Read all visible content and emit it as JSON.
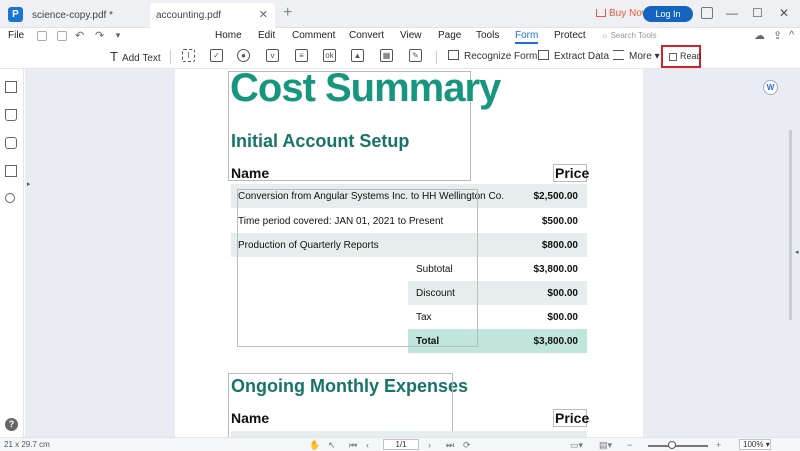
{
  "tabs": [
    {
      "label": "science-copy.pdf *"
    },
    {
      "label": "accounting.pdf"
    }
  ],
  "header": {
    "buy_now": "Buy Now",
    "login": "Log In"
  },
  "menu": {
    "file": "File",
    "items": [
      "Home",
      "Edit",
      "Comment",
      "Convert",
      "View",
      "Page",
      "Tools",
      "Form",
      "Protect"
    ],
    "active": "Form",
    "search_placeholder": "Search Tools"
  },
  "toolbar": {
    "add_text": "Add Text",
    "recognize_form": "Recognize Form",
    "extract_data": "Extract Data",
    "more": "More",
    "read": "Read"
  },
  "document": {
    "title": "Cost Summary",
    "section1": {
      "heading": "Initial Account Setup",
      "col_name": "Name",
      "col_price": "Price",
      "rows": [
        {
          "name": "Conversion from Angular Systems Inc. to HH Wellington Co.",
          "amount": "$2,500.00"
        },
        {
          "name": "Time period covered: JAN 01, 2021 to Present",
          "amount": "$500.00"
        },
        {
          "name": "Production of Quarterly Reports",
          "amount": "$800.00"
        }
      ],
      "summary": [
        {
          "label": "Subtotal",
          "amount": "$3,800.00"
        },
        {
          "label": "Discount",
          "amount": "$00.00"
        },
        {
          "label": "Tax",
          "amount": "$00.00"
        },
        {
          "label": "Total",
          "amount": "$3,800.00"
        }
      ]
    },
    "section2": {
      "heading": "Ongoing Monthly Expenses",
      "col_name": "Name",
      "col_price": "Price"
    }
  },
  "status": {
    "page_size": "21 x 29.7 cm",
    "page_indicator": "1/1",
    "zoom": "100%"
  },
  "colors": {
    "accent": "#1e6fd9",
    "title_green": "#17967f",
    "heading_green": "#17746a",
    "highlight_red": "#d32029"
  }
}
